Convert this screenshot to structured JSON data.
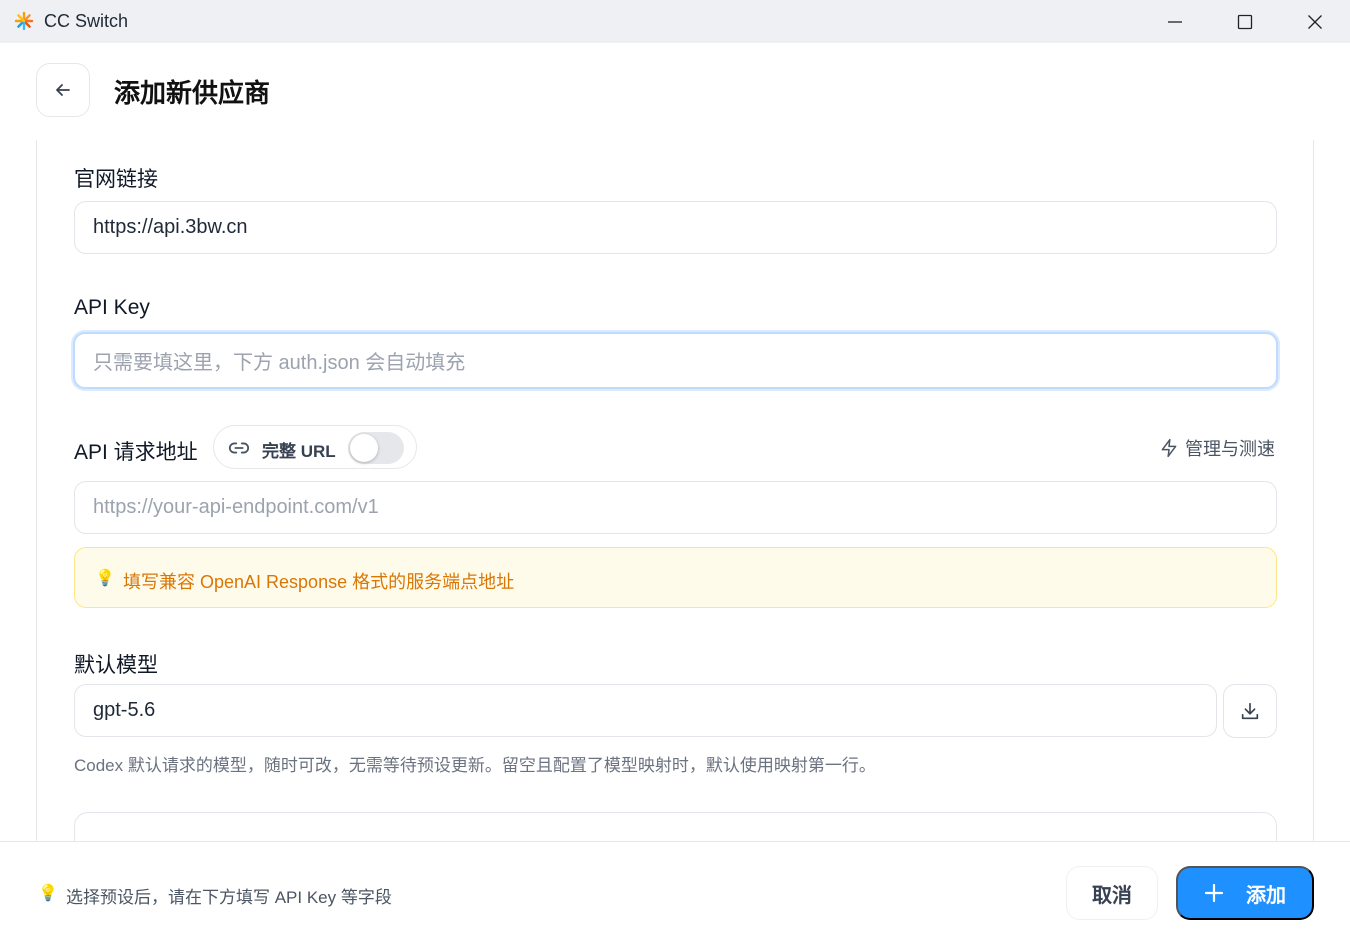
{
  "window": {
    "title": "CC Switch",
    "icon": "sunburst-app-icon",
    "controls": [
      "minimize-icon",
      "maximize-icon",
      "close-icon"
    ]
  },
  "header": {
    "title": "添加新供应商"
  },
  "form": {
    "website": {
      "label": "官网链接",
      "value": "https://api.3bw.cn"
    },
    "api_key": {
      "label": "API Key",
      "placeholder": "只需要填这里，下方 auth.json 会自动填充",
      "value": ""
    },
    "endpoint": {
      "label": "API 请求地址",
      "toggle_label": "完整 URL",
      "toggle_on": false,
      "manage_label": "管理与测速",
      "placeholder": "https://your-api-endpoint.com/v1",
      "hint": "填写兼容 OpenAI Response 格式的服务端点地址"
    },
    "model": {
      "label": "默认模型",
      "value": "gpt-5.6",
      "help": "Codex 默认请求的模型，随时可改，无需等待预设更新。留空且配置了模型映射时，默认使用映射第一行。"
    }
  },
  "footer": {
    "tip": "选择预设后，请在下方填写 API Key 等字段",
    "cancel_label": "取消",
    "add_label": "添加"
  },
  "colors": {
    "primary": "#1e90ff",
    "hint_bg": "#fffbeb",
    "hint_border": "#fde68a",
    "hint_text": "#d97706"
  }
}
